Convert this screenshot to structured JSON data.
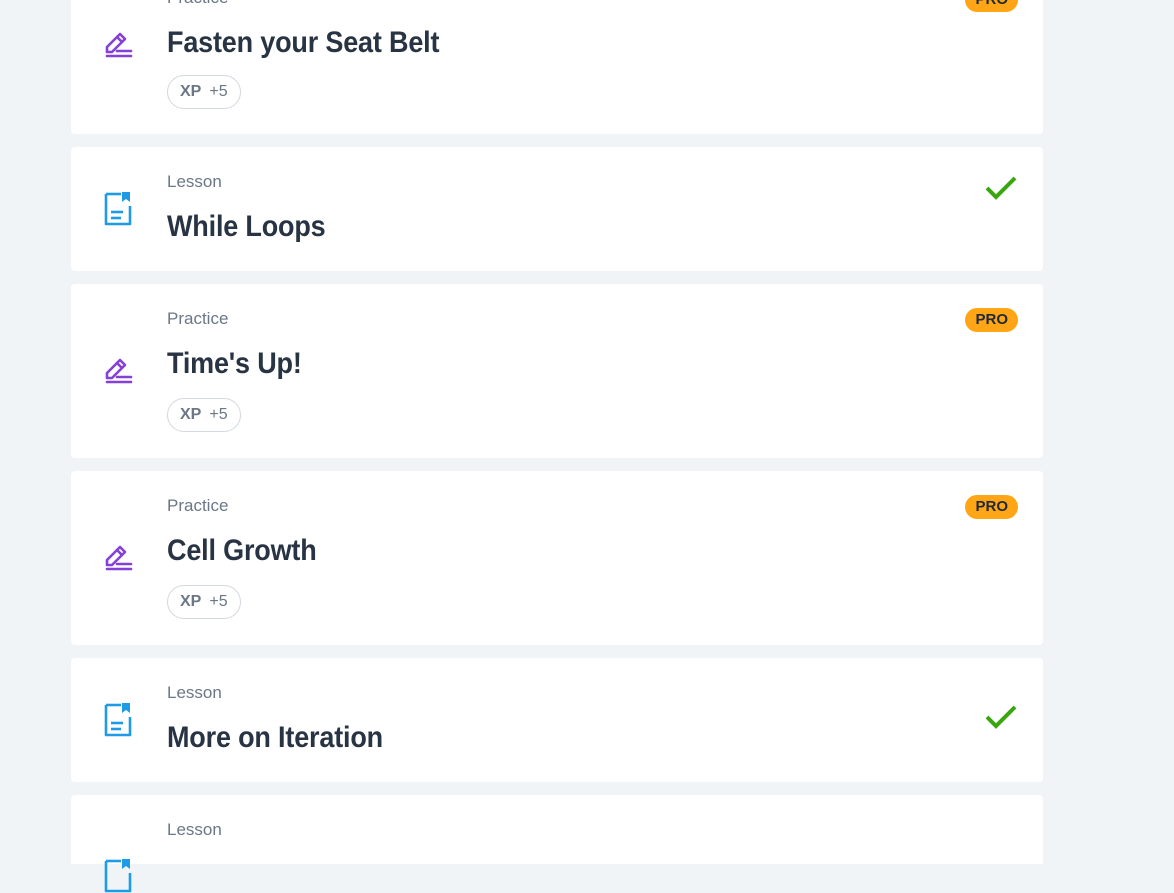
{
  "theme": {
    "practice_icon_color": "#8540d6",
    "lesson_icon_color": "#1f9be6",
    "pro_badge_color": "#ffa516",
    "check_color": "#3aa60f"
  },
  "items": [
    {
      "kind": "Practice",
      "title": "Fasten your Seat Belt",
      "xp_label": "XP",
      "xp_value": "+5",
      "pro": "PRO",
      "icon": "pencil-lines-icon"
    },
    {
      "kind": "Lesson",
      "title": "While Loops",
      "status": "completed",
      "icon": "document-bookmark-icon"
    },
    {
      "kind": "Practice",
      "title": "Time's Up!",
      "xp_label": "XP",
      "xp_value": "+5",
      "pro": "PRO",
      "icon": "pencil-lines-icon"
    },
    {
      "kind": "Practice",
      "title": "Cell Growth",
      "xp_label": "XP",
      "xp_value": "+5",
      "pro": "PRO",
      "icon": "pencil-lines-icon"
    },
    {
      "kind": "Lesson",
      "title": "More on Iteration",
      "status": "completed",
      "icon": "document-bookmark-icon"
    },
    {
      "kind": "Lesson",
      "title": "",
      "icon": "document-bookmark-icon"
    }
  ]
}
